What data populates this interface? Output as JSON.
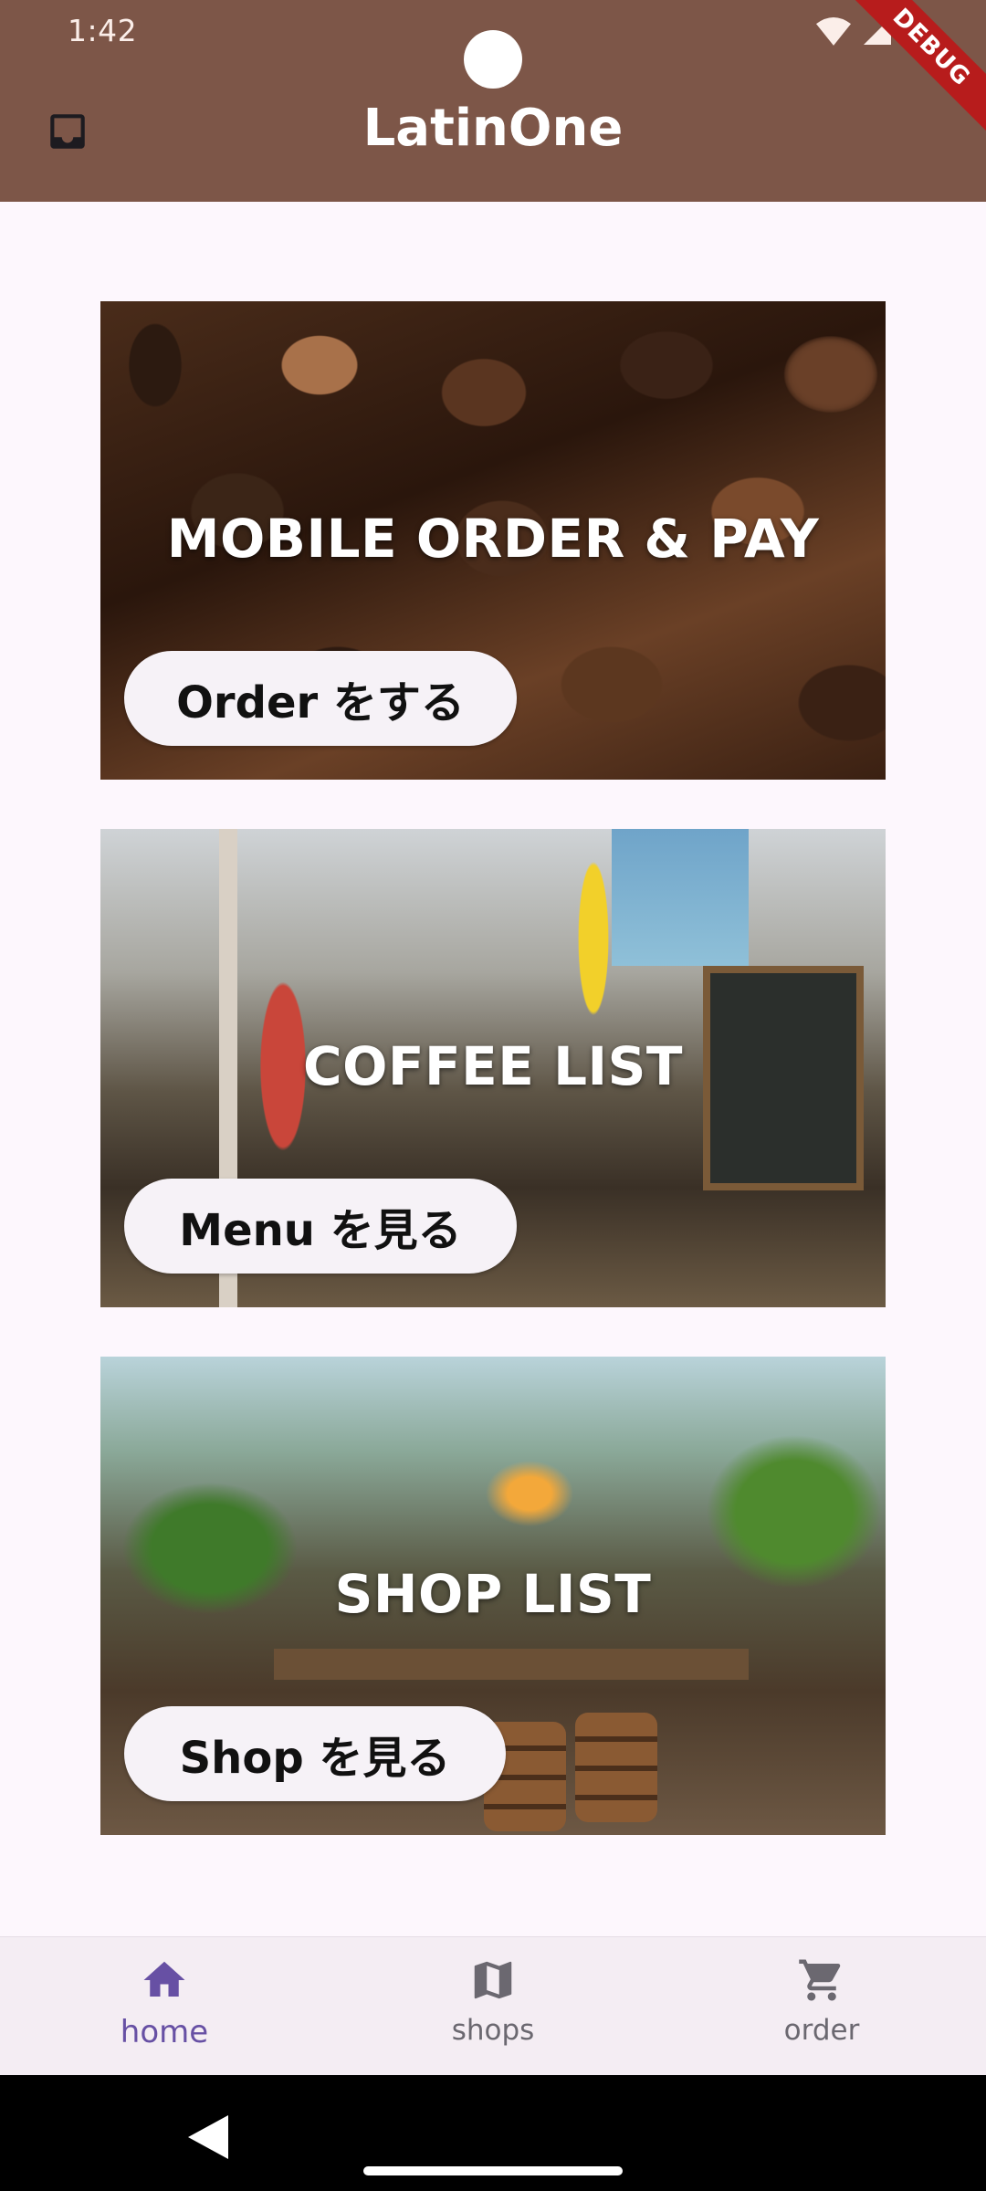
{
  "status_bar": {
    "time": "1:42",
    "debug_label": "DEBUG"
  },
  "app_bar": {
    "title": "LatinOne",
    "leading_icon": "inbox-icon",
    "background_color": "#7d5648"
  },
  "cards": [
    {
      "title": "MOBILE ORDER & PAY",
      "button_label": "Order をする",
      "image": "coffee-beans"
    },
    {
      "title": "COFFEE LIST",
      "button_label": "Menu を見る",
      "image": "cafe-interior"
    },
    {
      "title": "SHOP LIST",
      "button_label": "Shop を見る",
      "image": "shop-interior"
    }
  ],
  "bottom_nav": {
    "items": [
      {
        "label": "home",
        "icon": "home-icon",
        "active": true
      },
      {
        "label": "shops",
        "icon": "map-icon",
        "active": false
      },
      {
        "label": "order",
        "icon": "cart-icon",
        "active": false
      }
    ],
    "active_color": "#6750a4",
    "inactive_color": "#6b6870"
  }
}
